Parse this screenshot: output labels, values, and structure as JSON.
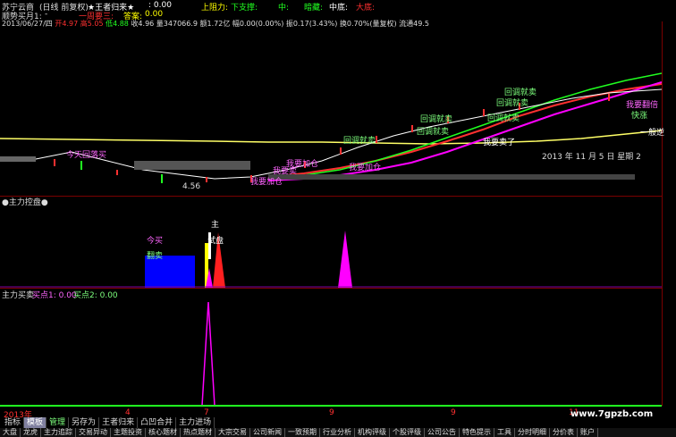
{
  "header": {
    "stock_name": "苏宁云商",
    "period": "(日线 前复权)",
    "indicator": "★王者归来★",
    "indicator_value": ": 0.00",
    "upper_resist_label": "上阻力:",
    "lower_support_label": "下支撑:",
    "mid_label": "中:",
    "dark_horse_label": "暗藏:",
    "mid_top_label": "中底:",
    "bull_label": "大底:",
    "accum_label": "顺势买月1:",
    "accum_value": "-",
    "hold_label": "一周要三:",
    "answer_label": "答案:",
    "answer_value": "0.00",
    "date_line": "2013/06/27/四",
    "open": "开4.97",
    "high": "高5.05",
    "low": "低4.88",
    "close": "收4.96",
    "volume": "量347066.9",
    "amount": "额1.72亿",
    "change": "幅0.00(0.00%)",
    "amplitude": "振0.17(3.43%)",
    "turnover": "换0.70%(量复权)",
    "circulation": "流通49.5"
  },
  "main_chart": {
    "annotations": [
      {
        "text": "今天回落买",
        "color": "#ff66ff"
      },
      {
        "text": "回调就卖",
        "color": "#7dff7d"
      },
      {
        "text": "回调就卖",
        "color": "#7dff7d"
      },
      {
        "text": "回调就卖",
        "color": "#7dff7d"
      },
      {
        "text": "回调就卖",
        "color": "#7dff7d"
      },
      {
        "text": "回调就卖",
        "color": "#7dff7d"
      },
      {
        "text": "回调就卖",
        "color": "#7dff7d"
      },
      {
        "text": "我要加仓",
        "color": "#ff66ff"
      },
      {
        "text": "我要加仓",
        "color": "#ff66ff"
      },
      {
        "text": "我要加仓",
        "color": "#ff66ff"
      },
      {
        "text": "我要卖",
        "color": "#ff66ff"
      },
      {
        "text": "我要卖了",
        "color": "#ffffff"
      },
      {
        "text": "我要翻倍",
        "color": "#ff66ff"
      },
      {
        "text": "快涨",
        "color": "#7dff7d"
      }
    ],
    "price_low": "4.56",
    "date_label": "2013 年 11 月 5 日 星期 2",
    "right_label": "一般逆"
  },
  "panel2": {
    "title": "●主力控盘●",
    "labels": [
      {
        "text": "今买",
        "color": "#ff66ff"
      },
      {
        "text": "翻卖",
        "color": "#7dff7d"
      },
      {
        "text": "主",
        "color": "#ffffff"
      },
      {
        "text": "试盘",
        "color": "#ffffff"
      }
    ]
  },
  "panel3": {
    "title": "主力买卖",
    "buy1": "买点1: 0.00",
    "buy2": "买点2: 0.00"
  },
  "xaxis": {
    "year": "2013年",
    "ticks": [
      "4",
      "7",
      "9",
      "9",
      "11"
    ]
  },
  "tabs": [
    "指标",
    "模板",
    "管理",
    "另存为",
    "王者归来",
    "凸凹合并",
    "主力进场"
  ],
  "bottom_tabs": [
    "大盘",
    "龙虎",
    "主力追踪",
    "交易异动",
    "主题投资",
    "核心题材",
    "热点题材",
    "大宗交易",
    "公司新闻",
    "一致预期",
    "行业分析",
    "机构评级",
    "个股评级",
    "公司公告",
    "特色提示",
    "工具",
    "分时明细",
    "分价表",
    "账户"
  ],
  "watermark": "www.7gpzb.com",
  "colors": {
    "yellow": "#ffff00",
    "red": "#ff2020",
    "green": "#20ff20",
    "magenta": "#ff00ff",
    "blue": "#0000ff",
    "white": "#ffffff"
  }
}
